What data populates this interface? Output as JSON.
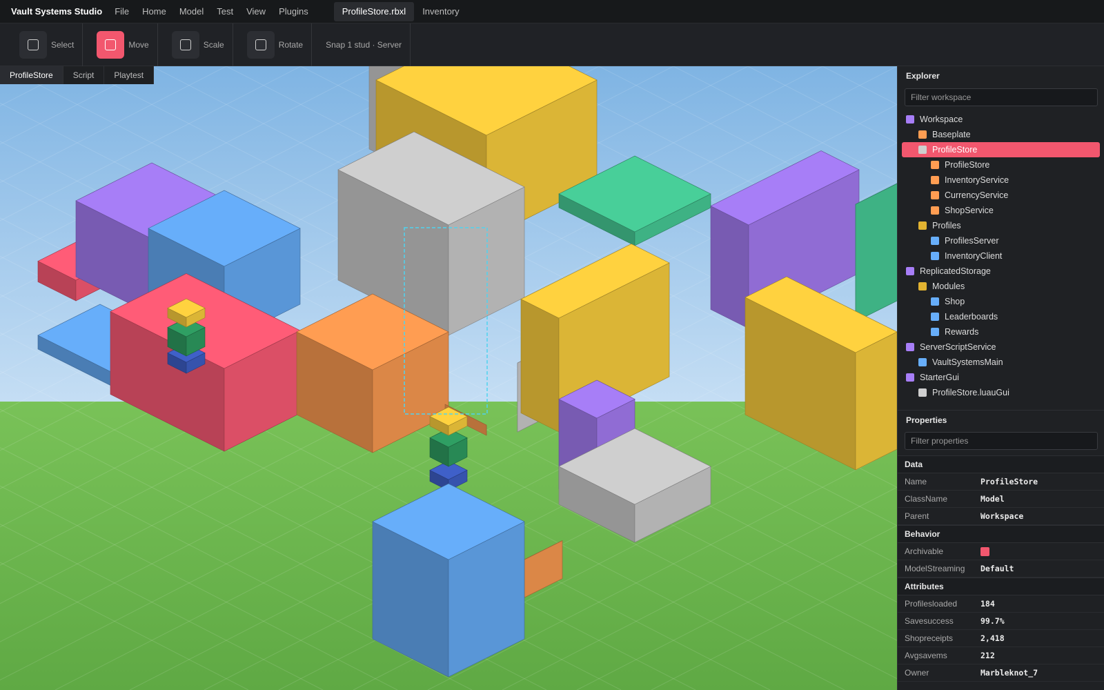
{
  "app": {
    "brand": "Vault Systems Studio"
  },
  "menu": [
    "File",
    "Home",
    "Model",
    "Test",
    "View",
    "Plugins"
  ],
  "doc_tabs": [
    {
      "label": "ProfileStore.rbxl",
      "active": true
    },
    {
      "label": "Inventory",
      "active": false
    }
  ],
  "toolbar": {
    "tools": [
      {
        "label": "Select",
        "icon": "square-icon",
        "active": false
      },
      {
        "label": "Move",
        "icon": "square-icon",
        "active": true
      },
      {
        "label": "Scale",
        "icon": "square-icon",
        "active": false
      },
      {
        "label": "Rotate",
        "icon": "square-icon",
        "active": false
      }
    ],
    "snap": "Snap 1 stud · Server"
  },
  "viewport_tabs": [
    {
      "label": "ProfileStore",
      "active": true
    },
    {
      "label": "Script",
      "active": false
    },
    {
      "label": "Playtest",
      "active": false
    }
  ],
  "colors": {
    "accent": "#f2576e",
    "sky_top": "#7fb4e3",
    "ground": "#6cb84f",
    "purple": "#a77ef7",
    "orange": "#ff9d52",
    "gray": "#cfcfcf",
    "yellow": "#e2b331",
    "blue": "#67aefa"
  },
  "explorer": {
    "title": "Explorer",
    "filter_placeholder": "Filter workspace",
    "items": [
      {
        "label": "Workspace",
        "depth": 0,
        "color": "#a77ef7",
        "selected": false
      },
      {
        "label": "Baseplate",
        "depth": 1,
        "color": "#ff9d52",
        "selected": false
      },
      {
        "label": "ProfileStore",
        "depth": 1,
        "color": "#cfcfcf",
        "selected": true
      },
      {
        "label": "ProfileStore",
        "depth": 2,
        "color": "#ff9d52",
        "selected": false
      },
      {
        "label": "InventoryService",
        "depth": 2,
        "color": "#ff9d52",
        "selected": false
      },
      {
        "label": "CurrencyService",
        "depth": 2,
        "color": "#ff9d52",
        "selected": false
      },
      {
        "label": "ShopService",
        "depth": 2,
        "color": "#ff9d52",
        "selected": false
      },
      {
        "label": "Profiles",
        "depth": 1,
        "color": "#e2b331",
        "selected": false
      },
      {
        "label": "ProfilesServer",
        "depth": 2,
        "color": "#67aefa",
        "selected": false
      },
      {
        "label": "InventoryClient",
        "depth": 2,
        "color": "#67aefa",
        "selected": false
      },
      {
        "label": "ReplicatedStorage",
        "depth": 0,
        "color": "#a77ef7",
        "selected": false
      },
      {
        "label": "Modules",
        "depth": 1,
        "color": "#e2b331",
        "selected": false
      },
      {
        "label": "Shop",
        "depth": 2,
        "color": "#67aefa",
        "selected": false
      },
      {
        "label": "Leaderboards",
        "depth": 2,
        "color": "#67aefa",
        "selected": false
      },
      {
        "label": "Rewards",
        "depth": 2,
        "color": "#67aefa",
        "selected": false
      },
      {
        "label": "ServerScriptService",
        "depth": 0,
        "color": "#a77ef7",
        "selected": false
      },
      {
        "label": "VaultSystemsMain",
        "depth": 1,
        "color": "#67aefa",
        "selected": false
      },
      {
        "label": "StarterGui",
        "depth": 0,
        "color": "#a77ef7",
        "selected": false
      },
      {
        "label": "ProfileStore.luauGui",
        "depth": 1,
        "color": "#cfcfcf",
        "selected": false
      }
    ]
  },
  "properties": {
    "title": "Properties",
    "filter_placeholder": "Filter properties",
    "sections": [
      {
        "title": "Data",
        "rows": [
          {
            "key": "Name",
            "value": "ProfileStore"
          },
          {
            "key": "ClassName",
            "value": "Model"
          },
          {
            "key": "Parent",
            "value": "Workspace"
          }
        ]
      },
      {
        "title": "Behavior",
        "rows": [
          {
            "key": "Archivable",
            "value": "",
            "checkbox": true
          },
          {
            "key": "ModelStreaming",
            "value": "Default"
          }
        ]
      },
      {
        "title": "Attributes",
        "rows": [
          {
            "key": "Profilesloaded",
            "value": "184"
          },
          {
            "key": "Savesuccess",
            "value": "99.7%"
          },
          {
            "key": "Shopreceipts",
            "value": "2,418"
          },
          {
            "key": "Avgsavems",
            "value": "212"
          },
          {
            "key": "Owner",
            "value": "Marbleknot_7"
          }
        ]
      }
    ]
  }
}
